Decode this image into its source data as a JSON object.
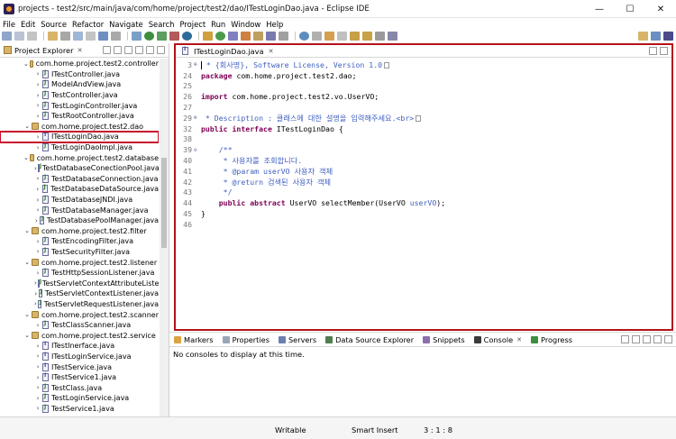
{
  "window": {
    "title": "projects - test2/src/main/java/com/home/project/test2/dao/ITestLoginDao.java - Eclipse IDE",
    "minimize": "—",
    "maximize": "☐",
    "close": "✕"
  },
  "menu": [
    "File",
    "Edit",
    "Source",
    "Refactor",
    "Navigate",
    "Search",
    "Project",
    "Run",
    "Window",
    "Help"
  ],
  "project_explorer": {
    "tab_label": "Project Explorer",
    "tab_close": "✕",
    "tree": [
      {
        "kind": "package",
        "label": "com.home.project.test2.controller",
        "expanded": true
      },
      {
        "kind": "class",
        "label": "ITestController.java"
      },
      {
        "kind": "class",
        "label": "ModelAndView.java"
      },
      {
        "kind": "class",
        "label": "TestController.java"
      },
      {
        "kind": "class",
        "label": "TestLoginController.java"
      },
      {
        "kind": "class",
        "label": "TestRootController.java"
      },
      {
        "kind": "package",
        "label": "com.home.project.test2.dao",
        "expanded": true
      },
      {
        "kind": "iface",
        "label": "ITestLoginDao.java",
        "selected": true
      },
      {
        "kind": "class",
        "label": "TestLoginDaoImpl.java"
      },
      {
        "kind": "package",
        "label": "com.home.project.test2.database",
        "expanded": true
      },
      {
        "kind": "class",
        "label": "TestDatabaseConectionPool.java"
      },
      {
        "kind": "class",
        "label": "TestDatabaseConnection.java"
      },
      {
        "kind": "class",
        "label": "TestDatabaseDataSource.java"
      },
      {
        "kind": "class",
        "label": "TestDatabaseJNDI.java"
      },
      {
        "kind": "class",
        "label": "TestDatabaseManager.java"
      },
      {
        "kind": "class",
        "label": "TestDatabasePoolManager.java"
      },
      {
        "kind": "package",
        "label": "com.home.project.test2.filter",
        "expanded": true
      },
      {
        "kind": "class",
        "label": "TestEncodingFilter.java"
      },
      {
        "kind": "class",
        "label": "TestSecurityFilter.java"
      },
      {
        "kind": "package",
        "label": "com.home.project.test2.listener",
        "expanded": true
      },
      {
        "kind": "class",
        "label": "TestHttpSessionListener.java"
      },
      {
        "kind": "class",
        "label": "TestServletContextAttributeListe"
      },
      {
        "kind": "class",
        "label": "TestServletContextListener.java"
      },
      {
        "kind": "class",
        "label": "TestServletRequestListener.java"
      },
      {
        "kind": "package",
        "label": "com.home.project.test2.scanner",
        "expanded": true
      },
      {
        "kind": "class",
        "label": "TestClassScanner.java"
      },
      {
        "kind": "package",
        "label": "com.home.project.test2.service",
        "expanded": true
      },
      {
        "kind": "iface",
        "label": "ITestInerface.java"
      },
      {
        "kind": "iface",
        "label": "ITestLoginService.java"
      },
      {
        "kind": "iface",
        "label": "ITestService.java"
      },
      {
        "kind": "iface",
        "label": "ITestService1.java"
      },
      {
        "kind": "class",
        "label": "TestClass.java"
      },
      {
        "kind": "class",
        "label": "TestLoginService.java"
      },
      {
        "kind": "class",
        "label": "TestService1.java"
      }
    ]
  },
  "editor": {
    "tab_label": "ITestLoginDao.java",
    "tab_close": "✕",
    "lines": [
      {
        "num": "3",
        "fold": "⊕",
        "parts": [
          {
            "t": " * {회사명}, Software License, Version 1.0",
            "c": "cm"
          }
        ],
        "box": true,
        "caret": true
      },
      {
        "num": "24",
        "parts": [
          {
            "t": "package",
            "c": "kw"
          },
          {
            "t": " com.home.project.test2.dao;",
            "c": ""
          }
        ]
      },
      {
        "num": "25",
        "parts": []
      },
      {
        "num": "26",
        "parts": [
          {
            "t": "import",
            "c": "kw"
          },
          {
            "t": " com.home.project.test2.vo.UserVO;",
            "c": ""
          }
        ]
      },
      {
        "num": "27",
        "parts": []
      },
      {
        "num": "29",
        "fold": "⊕",
        "parts": [
          {
            "t": " * Description : 클래스에 대한 설명을 입력해주세요.<br>",
            "c": "cm"
          }
        ],
        "box": true
      },
      {
        "num": "32",
        "parts": [
          {
            "t": "public interface",
            "c": "kw"
          },
          {
            "t": " ITestLoginDao {",
            "c": ""
          }
        ]
      },
      {
        "num": "38",
        "parts": []
      },
      {
        "num": "39",
        "fold": "⊖",
        "parts": [
          {
            "t": "    /**",
            "c": "cm"
          }
        ]
      },
      {
        "num": "40",
        "parts": [
          {
            "t": "     * 사용자를 조회합니다.",
            "c": "cm"
          }
        ]
      },
      {
        "num": "41",
        "parts": [
          {
            "t": "     * @param userVO 사용자 객체",
            "c": "cm"
          }
        ]
      },
      {
        "num": "42",
        "parts": [
          {
            "t": "     * @return 검색된 사용자 객체",
            "c": "cm"
          }
        ]
      },
      {
        "num": "43",
        "parts": [
          {
            "t": "     */",
            "c": "cm"
          }
        ]
      },
      {
        "num": "44",
        "parts": [
          {
            "t": "    public abstract",
            "c": "kw"
          },
          {
            "t": " UserVO selectMember(UserVO ",
            "c": ""
          },
          {
            "t": "userVO",
            "c": "cm"
          },
          {
            "t": ");",
            "c": ""
          }
        ]
      },
      {
        "num": "45",
        "parts": [
          {
            "t": "}",
            "c": ""
          }
        ]
      },
      {
        "num": "46",
        "parts": []
      }
    ]
  },
  "bottom_panel": {
    "tabs": [
      {
        "label": "Markers",
        "color": "#d9a441"
      },
      {
        "label": "Properties",
        "color": "#9aa6b8"
      },
      {
        "label": "Servers",
        "color": "#6b7fb0"
      },
      {
        "label": "Data Source Explorer",
        "color": "#4f7d4f"
      },
      {
        "label": "Snippets",
        "color": "#8a6fb0"
      },
      {
        "label": "Console",
        "color": "#3a3a3a",
        "active": true
      },
      {
        "label": "Progress",
        "color": "#3e8e3e"
      }
    ],
    "console_close": "✕",
    "message": "No consoles to display at this time."
  },
  "status": {
    "mode": "Writable",
    "insert": "Smart Insert",
    "position": "3 : 1 : 8"
  },
  "colors": {
    "highlight_box": "#c8102e",
    "editor_border": "#b5121b",
    "keyword": "#7f0055",
    "comment": "#3f5fbf"
  }
}
